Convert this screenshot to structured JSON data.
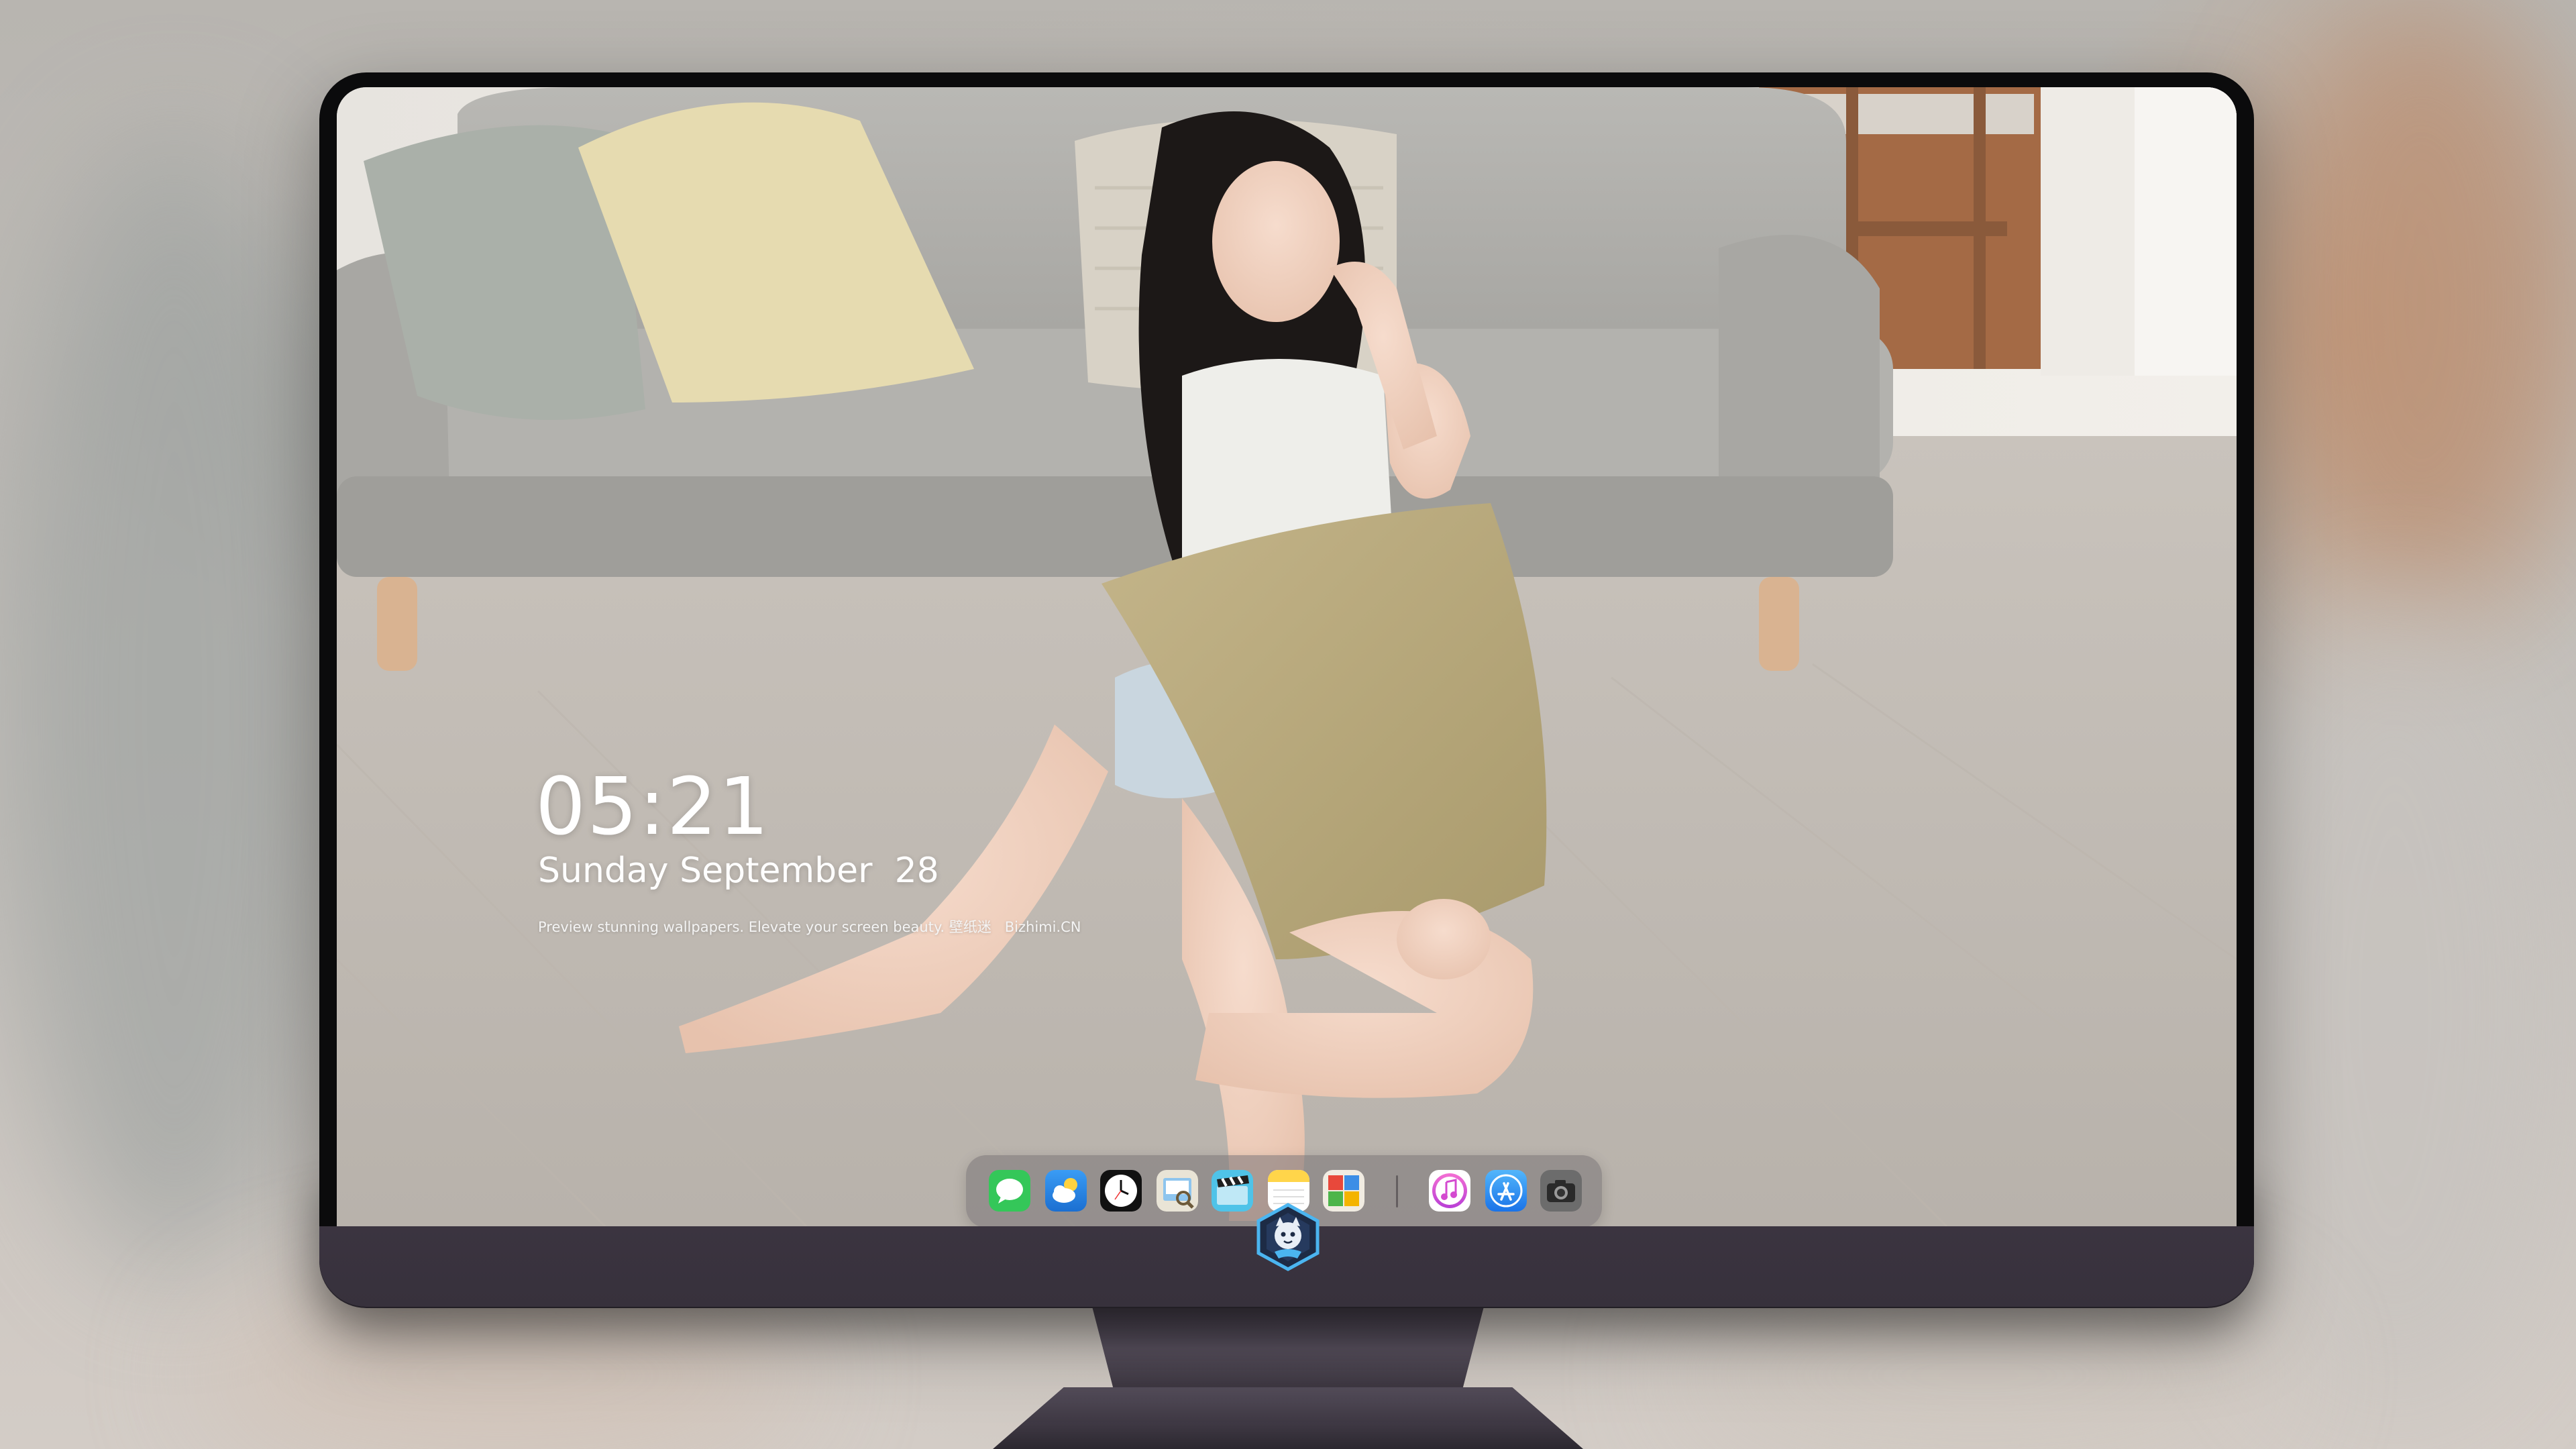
{
  "lock_screen": {
    "time": "05:21",
    "date": "Sunday September  28",
    "tagline": "Preview stunning wallpapers. Elevate your screen beauty. 壁纸迷   Bizhimi.CN"
  },
  "dock": {
    "apps": [
      {
        "name": "messages",
        "icon": "messages-icon",
        "color": "#34c759"
      },
      {
        "name": "weather",
        "icon": "weather-icon",
        "color": "#2f8cf0"
      },
      {
        "name": "clock",
        "icon": "clock-icon",
        "color": "#111111"
      },
      {
        "name": "preview",
        "icon": "preview-icon",
        "color": "#e9e4d6"
      },
      {
        "name": "clips",
        "icon": "clips-icon",
        "color": "#4fc3e8"
      },
      {
        "name": "notes",
        "icon": "notes-icon",
        "color": "#ffd54a"
      },
      {
        "name": "photo-booth",
        "icon": "photo-booth-icon",
        "color": "#f1ece2"
      },
      {
        "name": "music",
        "icon": "music-icon",
        "color": "#ea4cc0"
      },
      {
        "name": "app-store",
        "icon": "app-store-icon",
        "color": "#2f8cf0"
      },
      {
        "name": "camera",
        "icon": "camera-icon",
        "color": "#555555"
      }
    ]
  },
  "colors": {
    "bezel": "#0b0b0c",
    "chin": "#3b3440",
    "dock_glass": "rgba(120,115,118,0.55)"
  }
}
